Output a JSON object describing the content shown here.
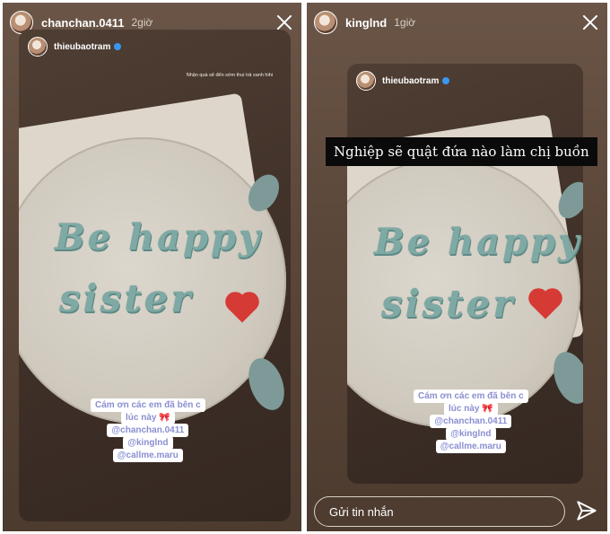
{
  "left_story": {
    "username": "chanchan.0411",
    "timestamp": "2giờ",
    "shared_post": {
      "username": "thieubaotram",
      "small_caption": "Nhận quà sẽ đến sớm thui trả xanh hihi",
      "cake_text_line1": "Be happy",
      "cake_text_line2": "sister",
      "sticker_lines": [
        "Cám ơn các em đã bên c",
        "lúc này 🎀",
        "@chanchan.0411",
        "@kinglnd",
        "@callme.maru"
      ]
    }
  },
  "right_story": {
    "username": "kinglnd",
    "timestamp": "1giờ",
    "overlay_caption": "Nghiệp sẽ quật đứa nào làm chị buồn",
    "shared_post": {
      "username": "thieubaotram",
      "cake_text_line1": "Be happy",
      "cake_text_line2": "sister",
      "sticker_lines": [
        "Cám ơn các em đã bên c",
        "lúc này 🎀",
        "@chanchan.0411",
        "@kinglnd",
        "@callme.maru"
      ]
    },
    "reply_placeholder": "Gửi tin nhắn"
  },
  "icons": {
    "close": "close-icon",
    "send": "send-icon",
    "verified": "verified-badge-icon"
  },
  "colors": {
    "verified": "#3897f0",
    "sticker_text": "#8a8fd1",
    "cake_frosting": "#7fa9a4",
    "heart": "#d63a34"
  }
}
